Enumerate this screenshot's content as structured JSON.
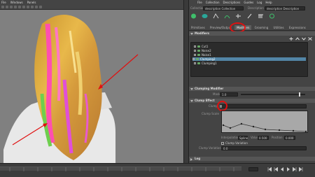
{
  "menubar": {
    "items": [
      "File",
      "Windows",
      "Panels"
    ]
  },
  "panel": {
    "menus": [
      "File",
      "Collection",
      "Descriptions",
      "Guides",
      "Log",
      "Help"
    ],
    "collection_label": "Collection",
    "collection_value": "description Collection",
    "description_label": "Description",
    "description_value": "description Description",
    "tabs": [
      "Primitives",
      "Preview/Output",
      "Modifiers",
      "Grooming",
      "Utilities",
      "Expressions"
    ],
    "active_tab": "Modifiers",
    "modifiers_header": "Modifiers",
    "modifier_stack": [
      {
        "label": "Cut1",
        "selected": false
      },
      {
        "label": "Noise2",
        "selected": false
      },
      {
        "label": "Noise1",
        "selected": false
      },
      {
        "label": "Clumping2",
        "selected": true
      },
      {
        "label": "Clumping1",
        "selected": false
      }
    ],
    "clumping_modifier_header": "Clumping Modifier",
    "mask_label": "Mask",
    "mask_value": "1.0",
    "clump_effect_header": "Clump Effect",
    "clump_label": "Clump",
    "clump_scale_label": "Clump Scale",
    "curve_controls": {
      "interpolation_label": "Interpolation",
      "interpolation_value": "Spline",
      "value_label": "Value",
      "value_value": "0.500",
      "position_label": "Position",
      "position_value": "0.000"
    },
    "clump_variation_label": "Clump Variation",
    "clump_variation_checkbox_label": "Clump Variation",
    "clump_variation_value": "0.0",
    "log_header": "Log"
  },
  "colors": {
    "accent_selected": "#5285a6",
    "annotation_red": "#e01010",
    "panel_bg": "#444444",
    "viewport_bg": "#808080"
  }
}
